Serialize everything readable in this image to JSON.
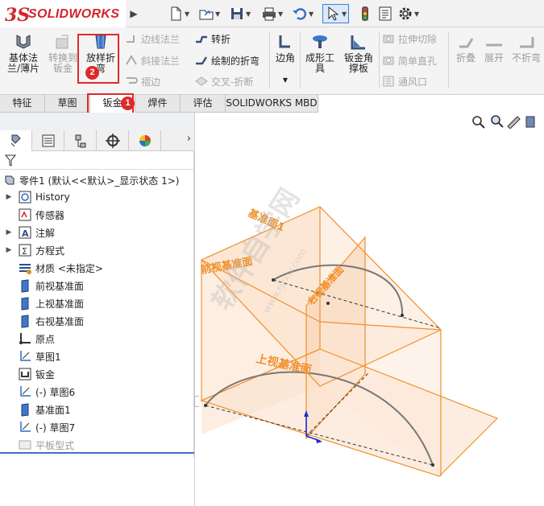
{
  "app": {
    "logo_mark": "3S",
    "logo_text": "SOLIDWORKS"
  },
  "quick_access": {
    "items": [
      "new-document-icon",
      "open-icon",
      "save-icon",
      "print-icon",
      "undo-icon",
      "select-icon",
      "traffic-light-icon",
      "properties-icon",
      "options-icon"
    ]
  },
  "ribbon": {
    "base_flange": "基体法\n兰/薄片",
    "convert_to_sheet": "转换到\n钣金",
    "lofted_bend": "放样折\n弯",
    "edge_flange": "边线法兰",
    "miter_flange": "斜接法兰",
    "hem": "褶边",
    "jog": "转折",
    "sketched_bend": "绘制的折弯",
    "cross_break": "交叉-折断",
    "corners": "边角",
    "forming_tool": "成形工\n具",
    "gusset": "钣金角\n撑板",
    "extruded_cut": "拉伸切除",
    "simple_hole": "简单直孔",
    "vent": "通风口",
    "fold": "折叠",
    "unfold": "展开",
    "no_bends": "不折弯"
  },
  "tabs": [
    "特征",
    "草图",
    "钣金",
    "焊件",
    "评估",
    "SOLIDWORKS MBD"
  ],
  "annotations": {
    "step1": "1",
    "step2": "2"
  },
  "tree": {
    "root": "零件1 (默认<<默认>_显示状态 1>)",
    "items": [
      {
        "label": "History",
        "expand": true,
        "icon": "history-icon"
      },
      {
        "label": "传感器",
        "expand": false,
        "icon": "sensor-icon"
      },
      {
        "label": "注解",
        "expand": true,
        "icon": "annotation-icon"
      },
      {
        "label": "方程式",
        "expand": true,
        "icon": "equation-icon"
      },
      {
        "label": "材质 <未指定>",
        "expand": false,
        "icon": "material-icon"
      },
      {
        "label": "前视基准面",
        "expand": false,
        "icon": "plane-icon"
      },
      {
        "label": "上视基准面",
        "expand": false,
        "icon": "plane-icon"
      },
      {
        "label": "右视基准面",
        "expand": false,
        "icon": "plane-icon"
      },
      {
        "label": "原点",
        "expand": false,
        "icon": "origin-icon"
      },
      {
        "label": "草图1",
        "expand": false,
        "icon": "sketch-icon"
      },
      {
        "label": "钣金",
        "expand": false,
        "icon": "sheet-metal-icon"
      },
      {
        "label": "(-) 草图6",
        "expand": false,
        "icon": "sketch-icon"
      },
      {
        "label": "基准面1",
        "expand": false,
        "icon": "plane-icon"
      },
      {
        "label": "(-) 草图7",
        "expand": false,
        "icon": "sketch-icon"
      },
      {
        "label": "平板型式",
        "expand": false,
        "icon": "flat-pattern-icon"
      }
    ]
  },
  "viewport": {
    "plane_labels": {
      "plane1": "基准面1",
      "front": "前视基准面",
      "right": "右视基准面",
      "top": "上视基准面"
    },
    "watermark": "软件自学网",
    "watermark_url": "www.rjzxw.com",
    "plane_color": "#f0902a",
    "fill_color": "#fbe3cf"
  }
}
